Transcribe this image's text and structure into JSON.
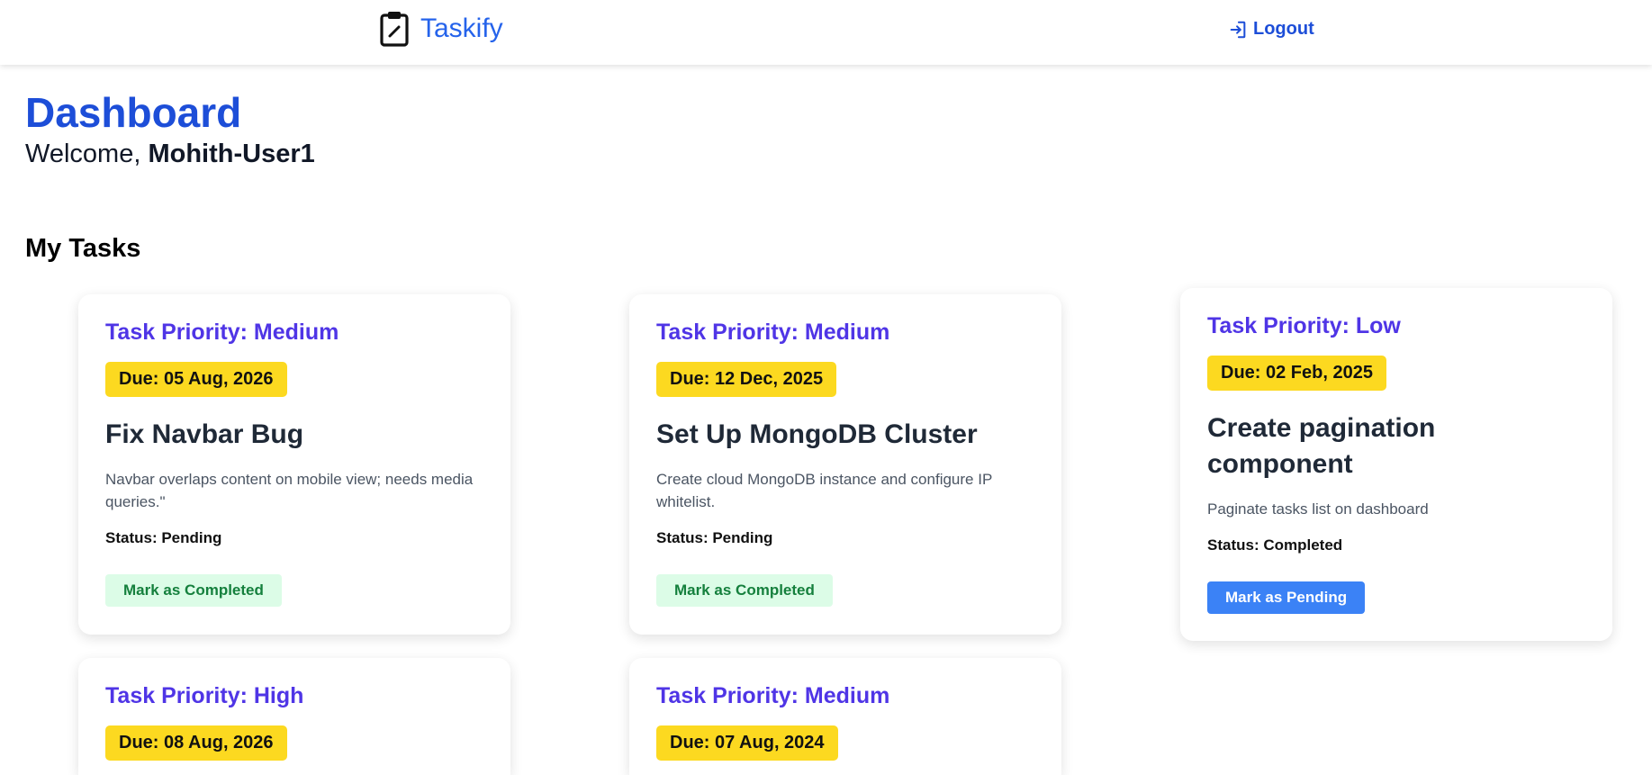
{
  "navbar": {
    "brand": "Taskify",
    "logout_label": "Logout"
  },
  "header": {
    "title": "Dashboard",
    "welcome_prefix": "Welcome, ",
    "username": "Mohith-User1"
  },
  "tasks_section": {
    "title": "My Tasks"
  },
  "tasks": [
    {
      "priority": "Task Priority: Medium",
      "due": "Due: 05 Aug, 2026",
      "title": "Fix Navbar Bug",
      "description": "Navbar overlaps content on mobile view; needs media queries.\"",
      "status": "Status: Pending",
      "action": "Mark as Completed"
    },
    {
      "priority": "Task Priority: Medium",
      "due": "Due: 12 Dec, 2025",
      "title": "Set Up MongoDB Cluster",
      "description": "Create cloud MongoDB instance and configure IP whitelist.",
      "status": "Status: Pending",
      "action": "Mark as Completed"
    },
    {
      "priority": "Task Priority: Low",
      "due": "Due: 02 Feb, 2025",
      "title": "Create pagination component",
      "description": "Paginate tasks list on dashboard",
      "status": "Status: Completed",
      "action": "Mark as Pending"
    },
    {
      "priority": "Task Priority: High",
      "due": "Due: 08 Aug, 2026"
    },
    {
      "priority": "Task Priority: Medium",
      "due": "Due: 07 Aug, 2024"
    }
  ],
  "colors": {
    "brand": "#2563eb",
    "priority": "#4f35e6",
    "due_badge": "#fcd920",
    "complete_button_bg": "#dcfce7",
    "pending_button_bg": "#3b82f6"
  },
  "icons": {
    "brand": "clipboard-edit-icon",
    "logout": "logout-icon"
  }
}
